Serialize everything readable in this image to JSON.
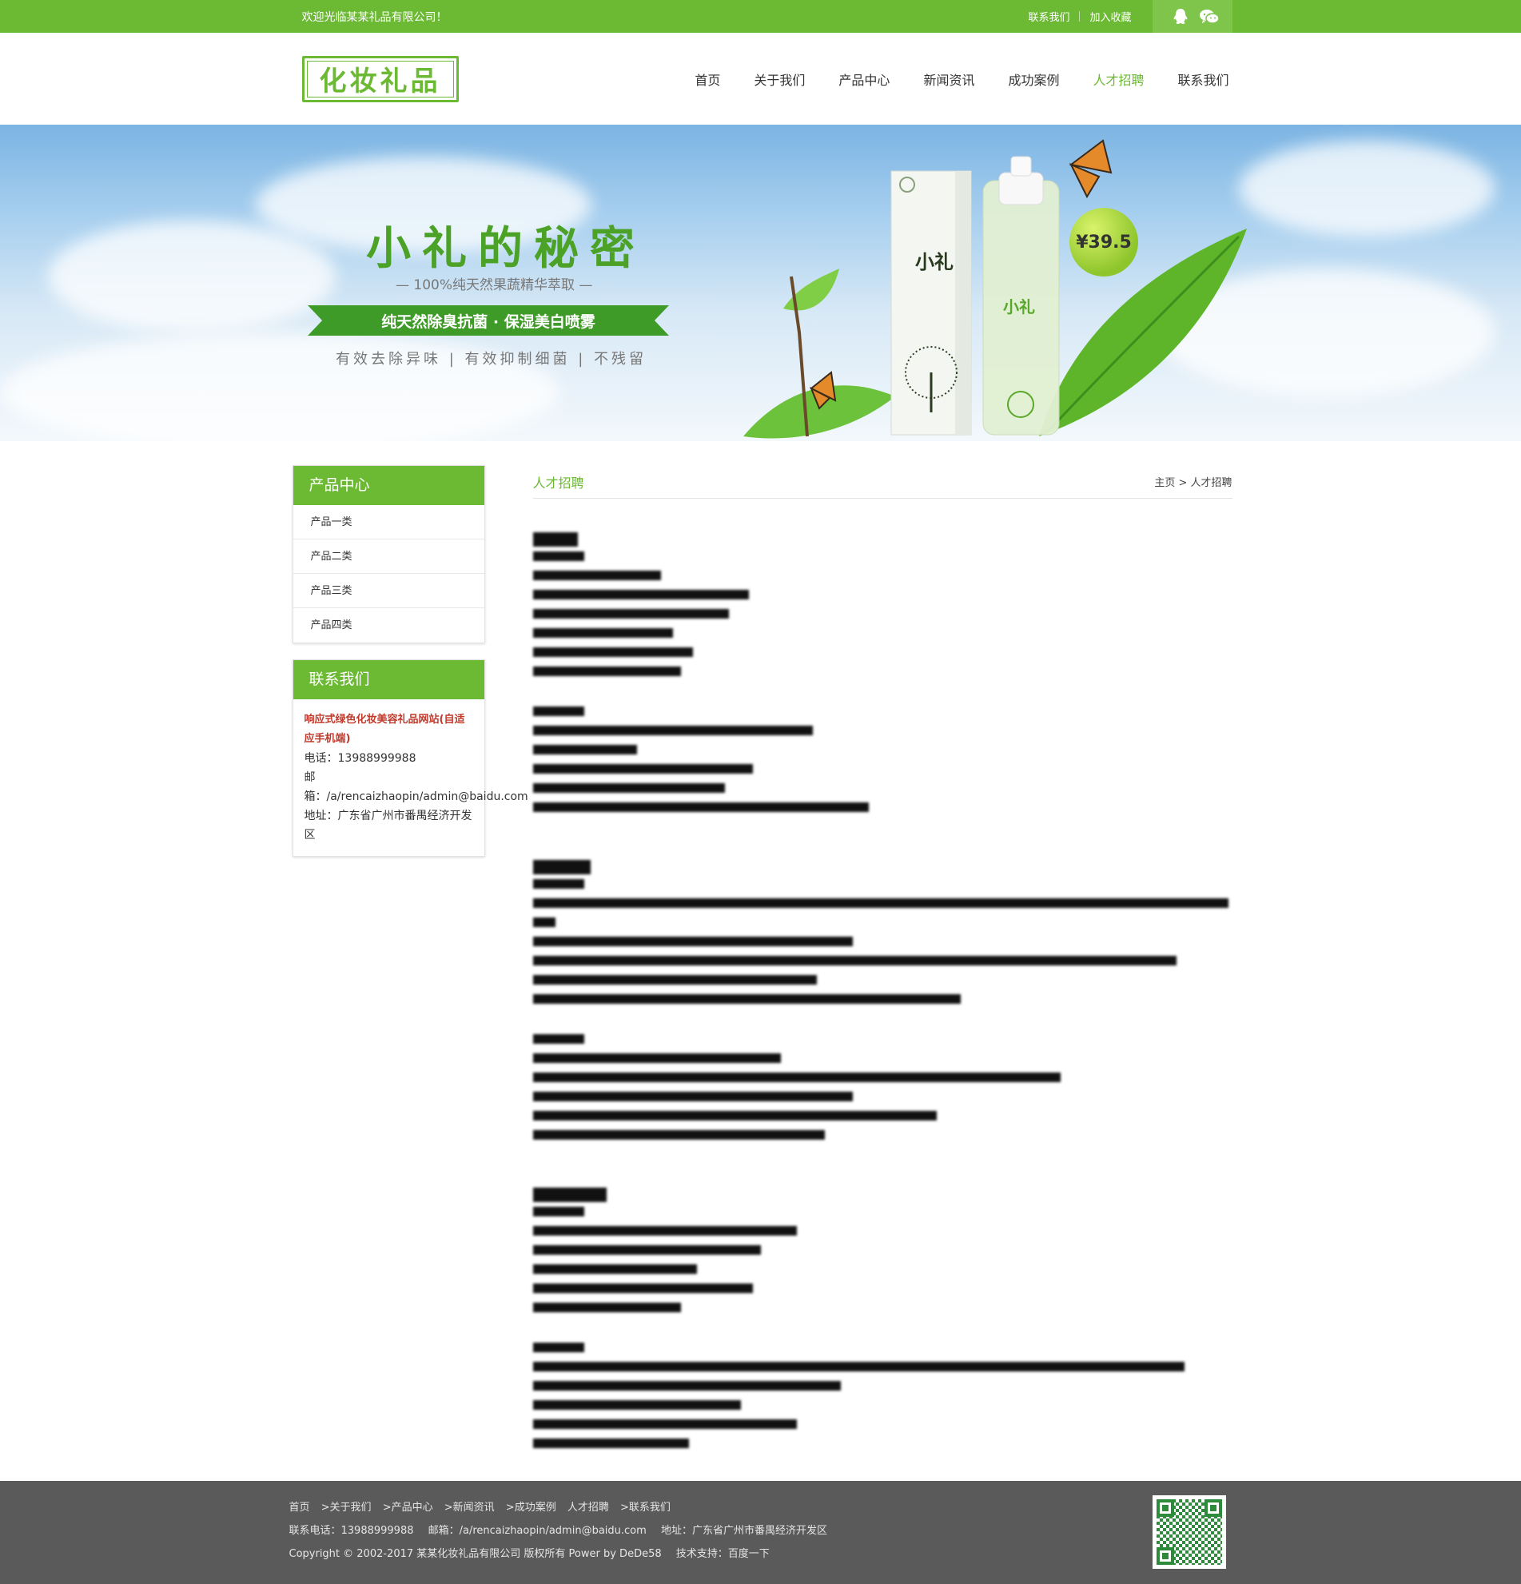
{
  "topbar": {
    "welcome": "欢迎光临某某礼品有限公司！",
    "links": [
      "联系我们",
      "加入收藏"
    ],
    "icons": [
      "qq-icon",
      "wechat-icon"
    ]
  },
  "header": {
    "logo_text": "化妆礼品",
    "nav": [
      "首页",
      "关于我们",
      "产品中心",
      "新闻资讯",
      "成功案例",
      "人才招聘",
      "联系我们"
    ],
    "active_nav": "人才招聘"
  },
  "banner": {
    "title": "小礼的秘密",
    "subtitle": "— 100%纯天然果蔬精华萃取 —",
    "ribbon": "纯天然除臭抗菌 · 保湿美白喷雾",
    "slogan": "有效去除异味 | 有效抑制细菌 | 不残留",
    "price": "¥39.5",
    "product_label": "小礼"
  },
  "sidebar": {
    "products_title": "产品中心",
    "products": [
      "产品一类",
      "产品二类",
      "产品三类",
      "产品四类"
    ],
    "contact_title": "联系我们",
    "company": "响应式绿色化妆美容礼品网站(自适应手机端)",
    "phone": "电话：13988999988",
    "email_label": "邮",
    "email": "箱：/a/rencaizhaopin/admin@baidu.com",
    "address": "地址：广东省广州市番禺经济开发区"
  },
  "content": {
    "section_title": "人才招聘",
    "breadcrumb": "主页 > 人才招聘"
  },
  "footer": {
    "links": [
      "首页",
      ">关于我们",
      ">产品中心",
      ">新闻资讯",
      ">成功案例",
      "人才招聘",
      ">联系我们"
    ],
    "contact_phone": "联系电话：13988999988",
    "contact_email": "邮箱：/a/rencaizhaopin/admin@baidu.com",
    "contact_address": "地址：广东省广州市番禺经济开发区",
    "copyright": "Copyright © 2002-2017 某某化妆礼品有限公司 版权所有 Power by DeDe58",
    "support": "技术支持：百度一下"
  },
  "colors": {
    "brand_green": "#6cb934",
    "footer_bg": "#5a5a5a",
    "company_red": "#c0392b"
  }
}
